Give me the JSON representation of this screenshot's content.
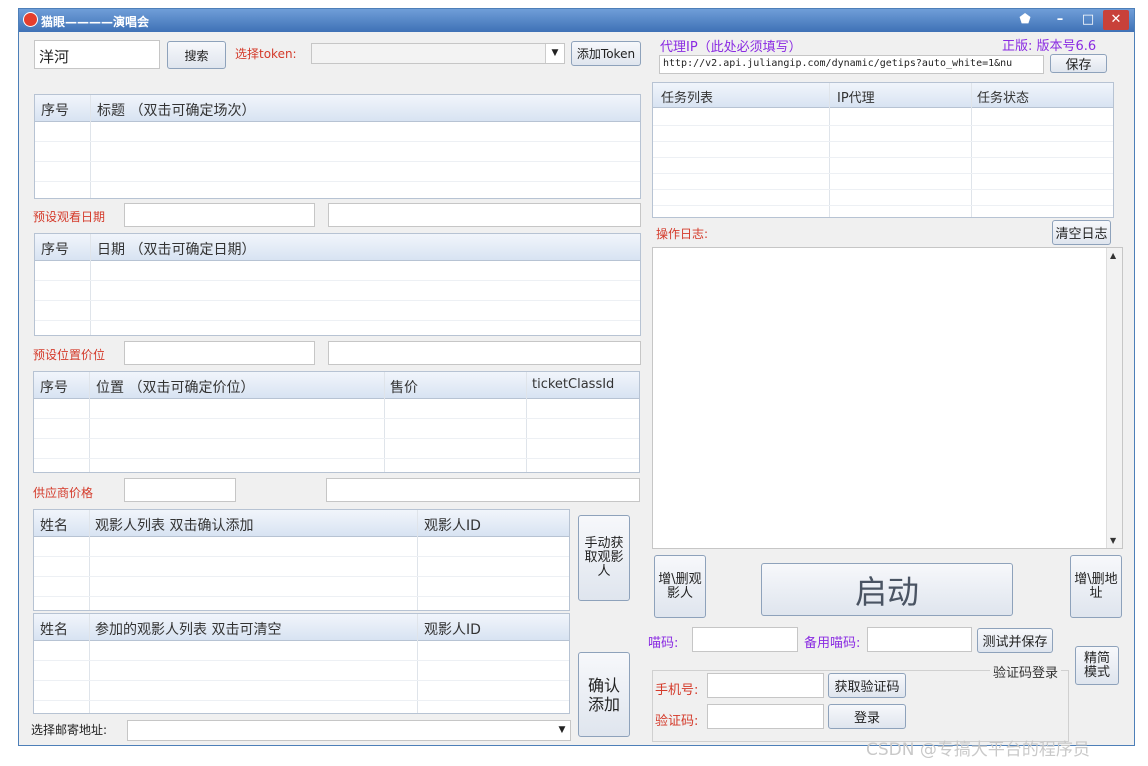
{
  "window": {
    "title": "猫眼————演唱会",
    "min_label": "–",
    "max_label": "□",
    "close_label": "✕"
  },
  "search": {
    "value": "洋河",
    "button": "搜索"
  },
  "token": {
    "label": "选择token:",
    "value": "",
    "add_button": "添加Token"
  },
  "proxy": {
    "label": "代理IP（此处必须填写）",
    "version": "正版: 版本号6.6",
    "url": "http://v2.api.juliangip.com/dynamic/getips?auto_white=1&nu",
    "save_button": "保存"
  },
  "show_table": {
    "headers": [
      "序号",
      "标题  （双击可确定场次）"
    ]
  },
  "date": {
    "label": "预设观看日期",
    "value1": "",
    "value2": "",
    "headers": [
      "序号",
      "日期  （双击可确定日期）"
    ]
  },
  "seat": {
    "label": "预设位置价位",
    "value1": "",
    "value2": "",
    "headers": [
      "序号",
      "位置  （双击可确定价位）",
      "售价",
      "ticketClassId"
    ]
  },
  "supplier": {
    "label": "供应商价格",
    "value1": "",
    "value2": ""
  },
  "viewers": {
    "headers": [
      "姓名",
      "观影人列表    双击确认添加",
      "观影人ID"
    ],
    "fetch_button": "手动获取观影人"
  },
  "added_viewers": {
    "headers": [
      "姓名",
      "参加的观影人列表    双击可清空",
      "观影人ID"
    ],
    "confirm_button": "确认添加"
  },
  "address": {
    "label": "选择邮寄地址:",
    "value": ""
  },
  "task_table": {
    "headers": [
      "任务列表",
      "IP代理",
      "任务状态"
    ]
  },
  "log": {
    "label": "操作日志:",
    "clear_button": "清空日志"
  },
  "controls": {
    "edit_viewers": "增\\删观影人",
    "start": "启动",
    "edit_address": "增\\删地址",
    "simple_mode": "精简模式"
  },
  "code": {
    "label": "喵码:",
    "backup_label": "备用喵码:",
    "value": "",
    "backup_value": "",
    "test_button": "测试并保存"
  },
  "login": {
    "group_label": "验证码登录",
    "phone_label": "手机号:",
    "phone_value": "",
    "get_code_button": "获取验证码",
    "code_label": "验证码:",
    "code_value": "",
    "login_button": "登录"
  },
  "watermark": "CSDN @专搞大平台的程序员",
  "colors": {
    "red_label": "#d43a2a",
    "purple": "#8a2be2",
    "titlebar": "#3f71b6"
  }
}
